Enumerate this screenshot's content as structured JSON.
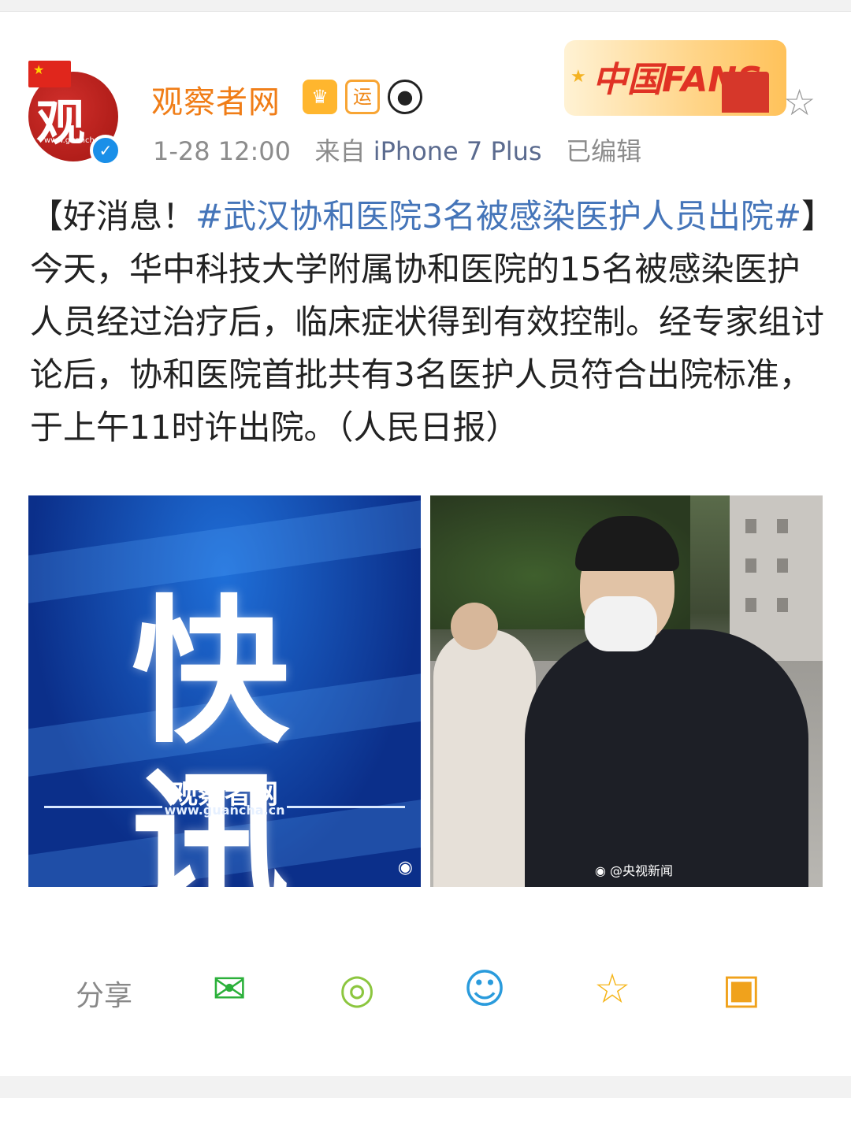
{
  "account": {
    "name": "观察者网",
    "avatar_text": "观",
    "avatar_url": "www.guancha",
    "badges": [
      "crown-vip",
      "运",
      "panda"
    ],
    "verified": "✓"
  },
  "meta": {
    "time": "1-28 12:00",
    "from_label": "来自",
    "source": "iPhone 7 Plus",
    "edited": "已编辑"
  },
  "fans_banner": {
    "text": "中国FANS"
  },
  "post": {
    "prefix": "【好消息！",
    "hashtag": "#武汉协和医院3名被感染医护人员出院#",
    "body": "】今天，华中科技大学附属协和医院的15名被感染医护人员经过治疗后，临床症状得到有效控制。经专家组讨论后，协和医院首批共有3名医护人员符合出院标准，于上午11时许出院。（人民日报）"
  },
  "images": {
    "left": {
      "title": "快 讯",
      "brand": "观察者网",
      "url": "www.guancha.cn"
    },
    "right": {
      "watermark": "@央视新闻"
    }
  },
  "share": {
    "label": "分享",
    "targets": [
      "wechat-icon",
      "moments-icon",
      "qq-icon",
      "qzone-icon",
      "save-image-icon"
    ]
  },
  "colors": {
    "username": "#f07d17",
    "hashtag": "#4575b9",
    "meta": "#8c8c8c"
  }
}
